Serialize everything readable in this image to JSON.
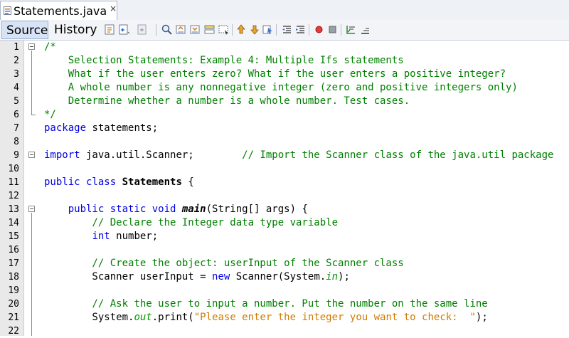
{
  "tab": {
    "filename": "Statements.java",
    "close": "×"
  },
  "view_tabs": {
    "source": "Source",
    "history": "History"
  },
  "toolbar_icons": [
    "last-edit-icon",
    "back-icon",
    "forward-icon",
    "find-icon",
    "find-previous-icon",
    "find-next-icon",
    "highlight-icon",
    "select-icon",
    "previous-bookmark-icon",
    "next-bookmark-icon",
    "toggle-bookmark-icon",
    "shift-left-icon",
    "shift-right-icon",
    "record-macro-icon",
    "stop-macro-icon",
    "comment-icon",
    "uncomment-icon"
  ],
  "line_numbers": [
    "1",
    "2",
    "3",
    "4",
    "5",
    "6",
    "7",
    "8",
    "9",
    "10",
    "11",
    "12",
    "13",
    "14",
    "15",
    "16",
    "17",
    "18",
    "19",
    "20",
    "21",
    "22"
  ],
  "code": {
    "l1": "/*",
    "l2": "    Selection Statements: Example 4: Multiple Ifs statements",
    "l3": "    What if the user enters zero? What if the user enters a positive integer?",
    "l4": "    A whole number is any nonnegative integer (zero and positive integers only)",
    "l5": "    Determine whether a number is a whole number. Test cases.",
    "l6": "*/",
    "l7_kw": "package",
    "l7_rest": " statements;",
    "l9_kw": "import",
    "l9_rest": " java.util.Scanner;        ",
    "l9_cm": "// Import the Scanner class of the java.util package",
    "l11_kw": "public class",
    "l11_sp": " ",
    "l11_name": "Statements",
    "l11_rest": " {",
    "l13_indent": "    ",
    "l13_kw": "public static void",
    "l13_sp": " ",
    "l13_name": "main",
    "l13_rest": "(String[] args) {",
    "l14": "        // Declare the Integer data type variable",
    "l15_indent": "        ",
    "l15_kw": "int",
    "l15_rest": " number;",
    "l17": "        // Create the object: userInput of the Scanner class",
    "l18_a": "        Scanner userInput = ",
    "l18_kw": "new",
    "l18_b": " Scanner(System.",
    "l18_it": "in",
    "l18_c": ");",
    "l20": "        // Ask the user to input a number. Put the number on the same line",
    "l21_a": "        System.",
    "l21_it": "out",
    "l21_b": ".print(",
    "l21_st": "\"Please enter the integer you want to check:  \"",
    "l21_c": ");"
  }
}
